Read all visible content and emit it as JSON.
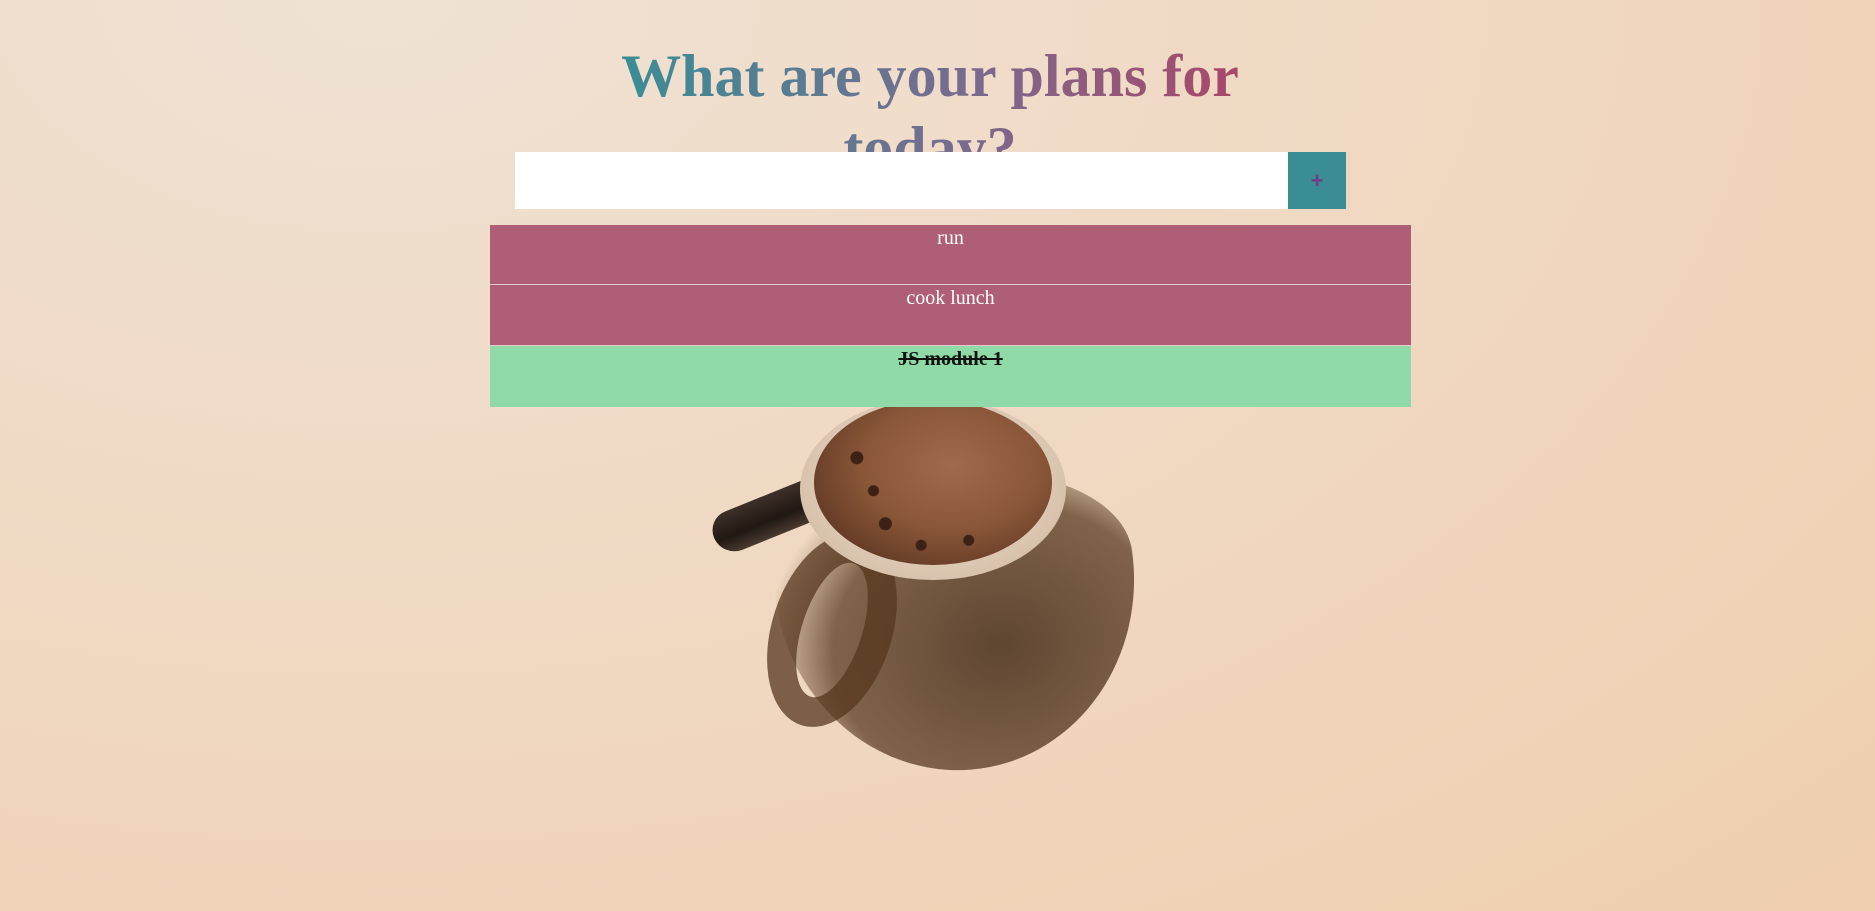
{
  "page": {
    "title": "What are your plans for today?"
  },
  "form": {
    "input_value": "",
    "input_placeholder": "",
    "add_label": "+"
  },
  "tasks": [
    {
      "label": "run",
      "status": "pending"
    },
    {
      "label": "cook lunch",
      "status": "pending"
    },
    {
      "label": "JS module 1",
      "status": "completed"
    }
  ],
  "colors": {
    "title_gradient_start": "#3a8d95",
    "title_gradient_end": "#a8486a",
    "add_button_bg": "#3a8d95",
    "pending_task_bg": "#ae5f75",
    "completed_task_bg": "#90daa8"
  },
  "background": {
    "image": "coffee-mug-photo"
  }
}
